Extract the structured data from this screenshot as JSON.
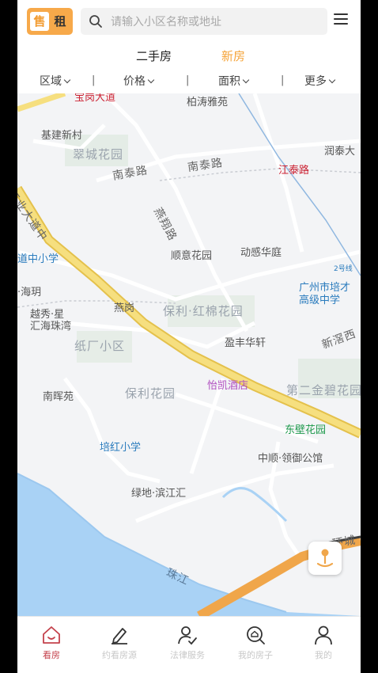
{
  "top": {
    "sell_label": "售",
    "rent_label": "租",
    "search_placeholder": "请输入小区名称或地址"
  },
  "types": {
    "used": "二手房",
    "new": "新房"
  },
  "filters": [
    {
      "label": "区域"
    },
    {
      "label": "价格"
    },
    {
      "label": "面积"
    },
    {
      "label": "更多"
    }
  ],
  "separator": "|",
  "map": {
    "labels": {
      "baigang": "宝岗大道",
      "baitao": "柏涛雅苑",
      "jijian": "基建新村",
      "cuicheng": "翠城花园",
      "nantai1": "南泰路",
      "nantai2": "南泰路",
      "jiangtai": "江泰路",
      "runtai": "润泰大",
      "gongye": "工业大道中",
      "yanxiang": "燕翔路",
      "shunyi": "顺意花园",
      "donggan": "动感华庭",
      "line2": "2号线",
      "daozhong": "道中小学",
      "peicai1": "广州市培才",
      "peicai2": "高级中学",
      "haiyue": "·海玥",
      "yuexiu1": "越秀·星",
      "yuexiu2": "汇海珠湾",
      "yangang": "燕岗",
      "baoli_hongmian": "保利·红棉花园",
      "zhichang": "纸厂小区",
      "yingfeng": "盈丰华轩",
      "xinjiao": "新滘西",
      "yikai": "怡凯酒店",
      "dier_jinbi": "第二金碧花园",
      "nanhui": "南晖苑",
      "baoli_garden": "保利花园",
      "dongbi": "东壁花园",
      "peihong": "培红小学",
      "zhongshun": "中顺·领御公馆",
      "lvdi": "绿地·滨江汇",
      "zhujiang": "珠江",
      "huancheng": "环城"
    }
  },
  "nav": [
    {
      "label": "看房",
      "icon": "home-icon",
      "active": true
    },
    {
      "label": "约看房源",
      "icon": "pen-icon",
      "active": false
    },
    {
      "label": "法律服务",
      "icon": "user-check-icon",
      "active": false
    },
    {
      "label": "我的房子",
      "icon": "house-search-icon",
      "active": false
    },
    {
      "label": "我的",
      "icon": "person-icon",
      "active": false
    }
  ],
  "colors": {
    "accent": "#f5a43a",
    "active_nav": "#c4424c",
    "metro": "#d6303a",
    "main_road": "#f2d26a",
    "river": "#a9d2f5"
  }
}
